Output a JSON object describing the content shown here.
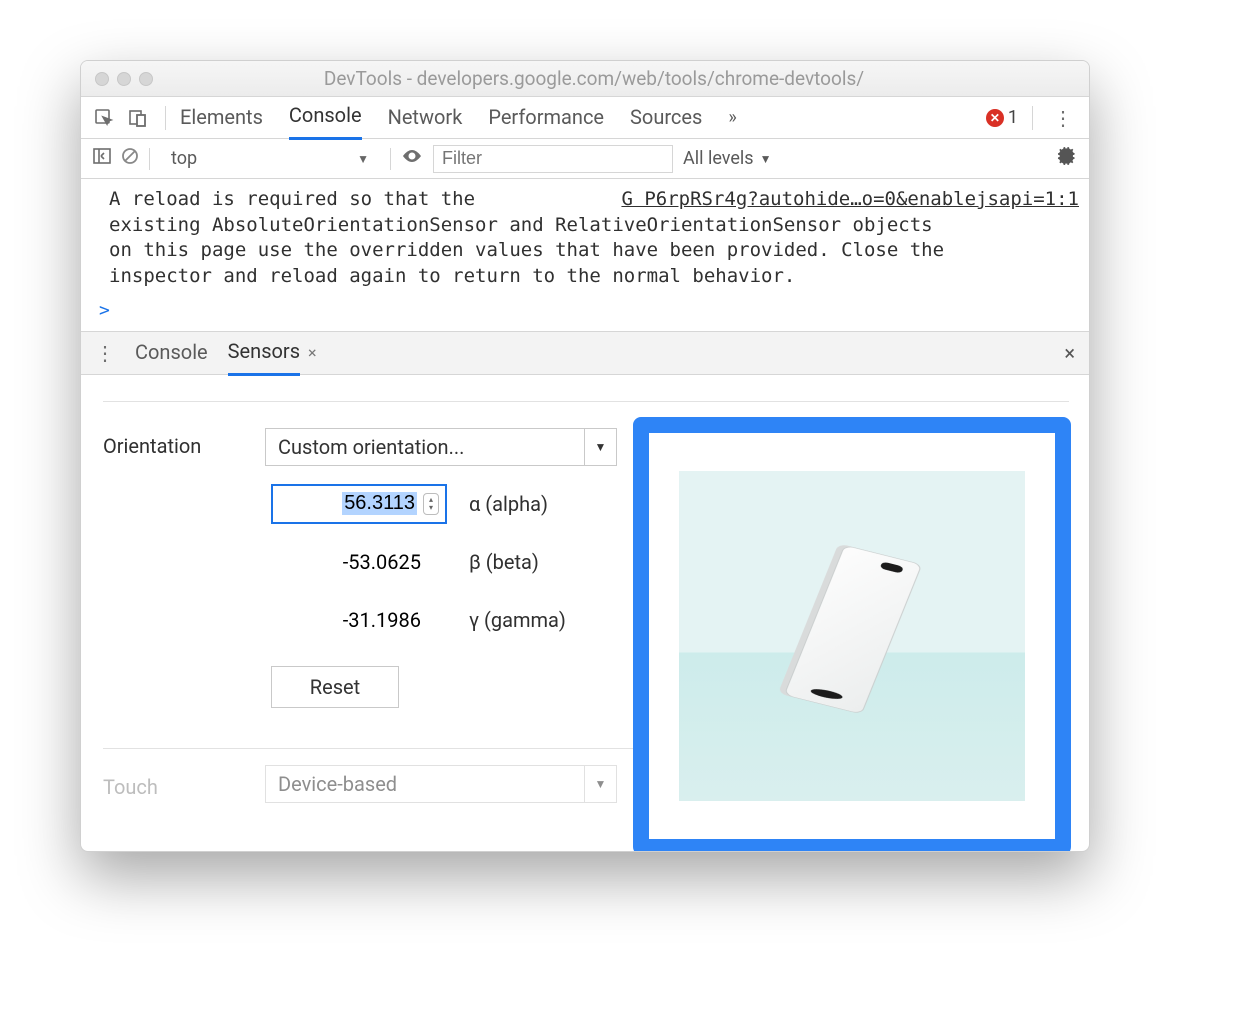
{
  "window": {
    "title": "DevTools - developers.google.com/web/tools/chrome-devtools/"
  },
  "mainTabs": {
    "elements": "Elements",
    "console": "Console",
    "network": "Network",
    "performance": "Performance",
    "sources": "Sources",
    "more": "»",
    "errorCount": "1"
  },
  "consoleToolbar": {
    "context": "top",
    "filterPlaceholder": "Filter",
    "levels": "All levels"
  },
  "consoleMessage": {
    "sourceLink": "G P6rpRSr4g?autohide…o=0&enablejsapi=1:1",
    "line1a": "A reload is required so that the",
    "line2": "existing AbsoluteOrientationSensor and RelativeOrientationSensor objects",
    "line3": "on this page use the overridden values that have been provided. Close the",
    "line4": "inspector and reload again to return to the normal behavior."
  },
  "prompt": ">",
  "drawer": {
    "console": "Console",
    "sensors": "Sensors",
    "closeX": "×",
    "panelClose": "×"
  },
  "sensors": {
    "orientationLabel": "Orientation",
    "orientationSelect": "Custom orientation...",
    "alpha": {
      "value": "56.3113",
      "label": "α (alpha)"
    },
    "beta": {
      "value": "-53.0625",
      "label": "β (beta)"
    },
    "gamma": {
      "value": "-31.1986",
      "label": "γ (gamma)"
    },
    "reset": "Reset",
    "touchLabel": "Touch",
    "touchSelect": "Device-based"
  }
}
